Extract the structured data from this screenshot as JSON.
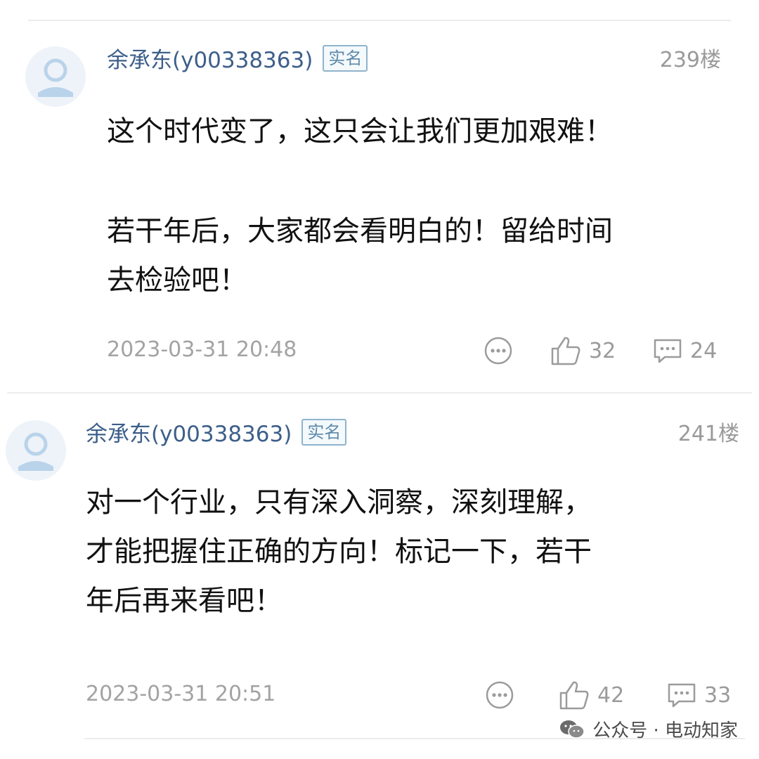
{
  "comments": [
    {
      "username": "余承东(y00338363)",
      "badge": "实名",
      "floor": "239楼",
      "paragraphs": [
        [
          "这个时代变了，这只会让我们更加艰难！"
        ],
        [
          "若干年后，大家都会看明白的！留给时间",
          "去检验吧！"
        ]
      ],
      "timestamp": "2023-03-31 20:48",
      "likes": "32",
      "replies": "24"
    },
    {
      "username": "余承东(y00338363)",
      "badge": "实名",
      "floor": "241楼",
      "paragraphs": [
        [
          "对一个行业，只有深入洞察，深刻理解，",
          "才能把握住正确的方向！标记一下，若干",
          "年后再来看吧！"
        ]
      ],
      "timestamp": "2023-03-31 20:51",
      "likes": "42",
      "replies": "33"
    }
  ],
  "watermark": {
    "text": "公众号 · 电动知家"
  },
  "icons": {
    "avatar": "default-avatar-icon",
    "more": "more-options-icon",
    "like": "thumbs-up-icon",
    "reply": "comment-bubble-icon",
    "watermark": "wechat-icon"
  },
  "colors": {
    "username": "#3d5f8a",
    "badge_border": "#8fb3cc",
    "meta_gray": "#9a9a9a",
    "body_text": "#111111"
  }
}
